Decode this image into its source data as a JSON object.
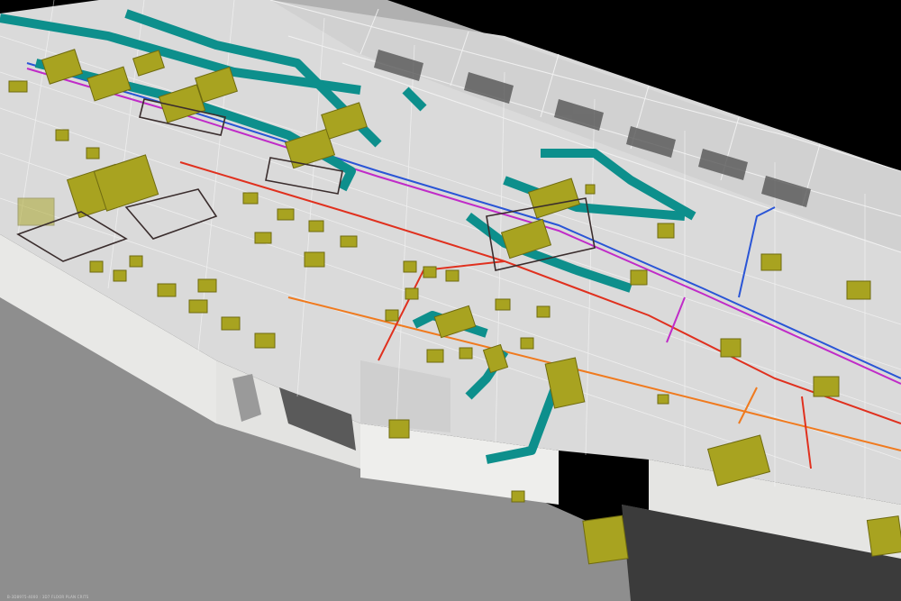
{
  "viewer": {
    "caption": "B-3D8975-4000 : 3D7 FLOOR PLAN CRITS"
  },
  "palette": {
    "background": "#000000",
    "ground": "#8f8f8f",
    "facade": "#e6e6e4",
    "roof_deck": "#d9d9d9",
    "structure_line": "#ffffff",
    "duct": "#0d8f8c",
    "equipment": "#a8a320",
    "pipe_red": "#e0301e",
    "pipe_blue": "#2a55d6",
    "pipe_magenta": "#c02bc8",
    "pipe_orange": "#f07a1e"
  }
}
